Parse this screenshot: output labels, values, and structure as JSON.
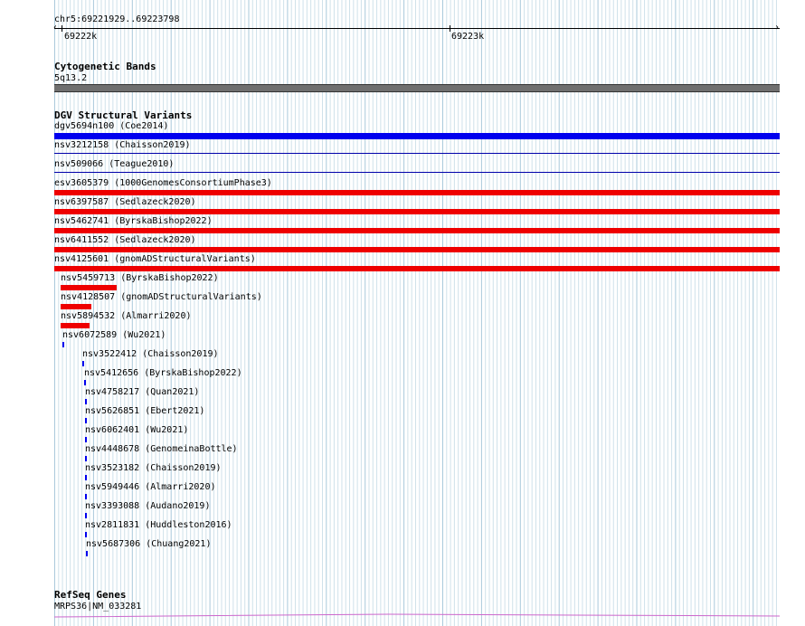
{
  "browser": {
    "position": "chr5:69221929..69223798",
    "ruler_labels": [
      "69222k",
      "69223k"
    ]
  },
  "cytobands": {
    "title": "Cytogenetic Bands",
    "band": "5q13.2"
  },
  "dgv": {
    "title": "DGV Structural Variants",
    "variants": [
      {
        "label": "dgv5694n100 (Coe2014)",
        "color": "#0000ee"
      },
      {
        "label": "nsv3212158 (Chaisson2019)",
        "color": "#0000aa"
      },
      {
        "label": "nsv509066 (Teague2010)",
        "color": "#0000aa"
      },
      {
        "label": "esv3605379 (1000GenomesConsortiumPhase3)",
        "color": "#ee0000"
      },
      {
        "label": "nsv6397587 (Sedlazeck2020)",
        "color": "#ee0000"
      },
      {
        "label": "nsv5462741 (ByrskaBishop2022)",
        "color": "#ee0000"
      },
      {
        "label": "nsv6411552 (Sedlazeck2020)",
        "color": "#ee0000"
      },
      {
        "label": "nsv4125601 (gnomADStructuralVariants)",
        "color": "#ee0000"
      },
      {
        "label": "nsv5459713 (ByrskaBishop2022)",
        "color": "#ee0000"
      },
      {
        "label": "nsv4128507 (gnomADStructuralVariants)",
        "color": "#ee0000"
      },
      {
        "label": "nsv5894532 (Almarri2020)",
        "color": "#ee0000"
      },
      {
        "label": "nsv6072589 (Wu2021)",
        "color": "#0000ee"
      },
      {
        "label": "nsv3522412 (Chaisson2019)",
        "color": "#0000ee"
      },
      {
        "label": "nsv5412656 (ByrskaBishop2022)",
        "color": "#0000ee"
      },
      {
        "label": "nsv4758217 (Quan2021)",
        "color": "#0000ee"
      },
      {
        "label": "nsv5626851 (Ebert2021)",
        "color": "#0000ee"
      },
      {
        "label": "nsv6062401 (Wu2021)",
        "color": "#0000ee"
      },
      {
        "label": "nsv4448678 (GenomeinaBottle)",
        "color": "#0000ee"
      },
      {
        "label": "nsv3523182 (Chaisson2019)",
        "color": "#0000ee"
      },
      {
        "label": "nsv5949446 (Almarri2020)",
        "color": "#0000ee"
      },
      {
        "label": "nsv3393088 (Audano2019)",
        "color": "#0000ee"
      },
      {
        "label": "nsv2811831 (Huddleston2016)",
        "color": "#0000ee"
      },
      {
        "label": "nsv5687306 (Chuang2021)",
        "color": "#0000ee"
      }
    ]
  },
  "refseq": {
    "title": "RefSeq Genes",
    "gene": "MRPS36|NM_033281",
    "color": "#cc66cc"
  }
}
